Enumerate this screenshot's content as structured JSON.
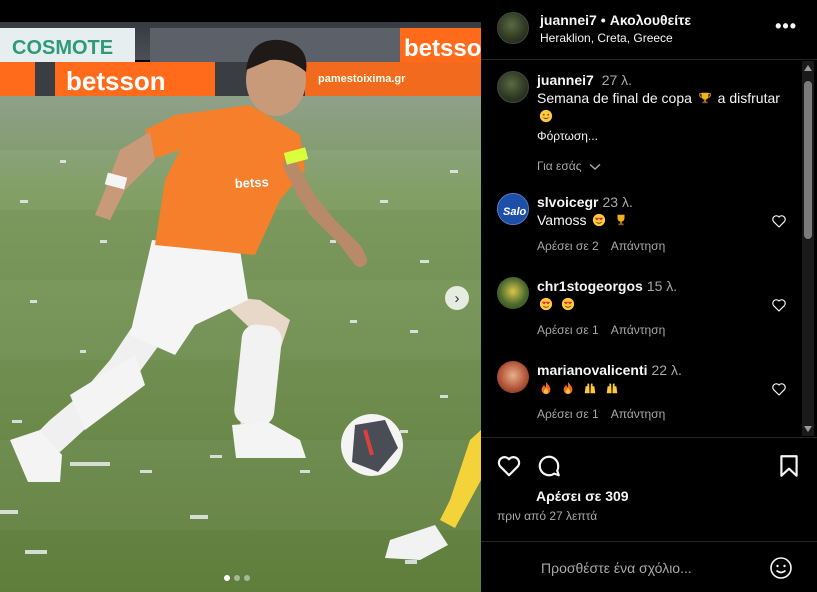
{
  "post": {
    "photo_alt": "Football player in orange kit dribbling the ball",
    "banner_ads": [
      "COSMOTE",
      "betsson",
      "betsson",
      "pamestoixima.gr"
    ],
    "carousel": {
      "total": 3,
      "active": 0
    }
  },
  "header": {
    "username": "juannei7",
    "separator": "•",
    "follow_label": "Ακολουθείτε",
    "location": "Heraklion, Creta, Greece",
    "more_label": "•••"
  },
  "caption": {
    "username": "juannei7",
    "time": "27 λ.",
    "text_before": "Semana de final de copa",
    "text_after": "a disfrutar",
    "loading": "Φόρτωση...",
    "for_you": "Για εσάς"
  },
  "comments": [
    {
      "username": "slvoicegr",
      "time": "23 λ.",
      "text": "Vamoss",
      "emoji": [
        "heart-eyes",
        "trophy"
      ],
      "likes": "Αρέσει σε 2",
      "reply": "Απάντηση"
    },
    {
      "username": "chr1stogeorgos",
      "time": "15 λ.",
      "text": "",
      "emoji": [
        "heart-eyes",
        "heart-eyes"
      ],
      "likes": "Αρέσει σε 1",
      "reply": "Απάντηση"
    },
    {
      "username": "marianovalicenti",
      "time": "22 λ.",
      "text": "",
      "emoji": [
        "fire",
        "fire",
        "raised-hands",
        "raised-hands"
      ],
      "likes": "Αρέσει σε 1",
      "reply": "Απάντηση"
    }
  ],
  "actions": {
    "likes": "Αρέσει σε 309",
    "time_ago": "πριν από 27 λεπτά"
  },
  "add_comment": {
    "placeholder": "Προσθέστε ένα σχόλιο..."
  },
  "colors": {
    "background": "#000000",
    "secondary_text": "#a8a8a8",
    "jersey_orange": "#f57f2a"
  }
}
